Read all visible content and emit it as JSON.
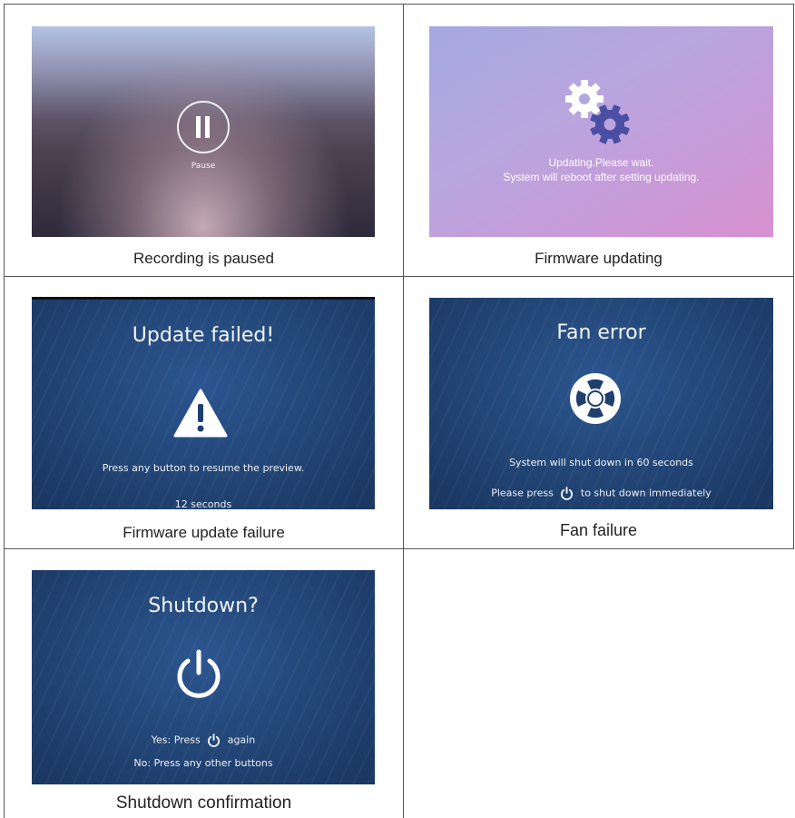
{
  "cells": {
    "paused": {
      "caption": "Recording is paused",
      "screen_label": "Pause"
    },
    "firmware_updating": {
      "caption": "Firmware updating",
      "line1": "Updating.Please wait.",
      "line2": "System will reboot after setting updating."
    },
    "update_failure": {
      "caption": "Firmware update failure",
      "title": "Update failed!",
      "message": "Press any button to resume the preview.",
      "countdown": "12 seconds"
    },
    "fan_failure": {
      "caption": "Fan failure",
      "title": "Fan error",
      "message": "System will shut down in 60 seconds",
      "press_prefix": "Please press",
      "press_suffix": "to shut down immediately"
    },
    "shutdown": {
      "caption": "Shutdown confirmation",
      "title": "Shutdown?",
      "yes_prefix": "Yes: Press",
      "yes_suffix": "again",
      "no_text": "No: Press any other buttons"
    }
  },
  "icons": {
    "pause": "pause-icon",
    "gears": "gears-icon",
    "warning": "warning-icon",
    "fan": "fan-icon",
    "power": "power-icon"
  },
  "colors": {
    "screen_blue": "#234879",
    "update_gradient_start": "#a7a6e0",
    "update_gradient_end": "#d18fd0",
    "gear_white": "#ffffff",
    "gear_blue": "#4b4fa4",
    "border": "#555555"
  }
}
